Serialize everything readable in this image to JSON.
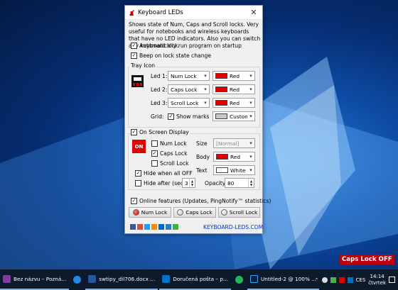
{
  "window": {
    "title": "Keyboard LEDs",
    "close_icon": "close-icon"
  },
  "description": "Shows state of Num, Caps and Scroll locks. Very useful for notebooks and wireless keyboards that have no LED indicators. Also you can switch any keyboard lock.",
  "options": {
    "autorun": "Automatically run program on startup",
    "beep": "Beep on lock state change"
  },
  "tray": {
    "group_label": "Tray Icon",
    "leds": [
      {
        "label": "Led 1:",
        "lock": "Num Lock",
        "color": "Red",
        "color_hex": "#e00000"
      },
      {
        "label": "Led 2:",
        "lock": "Caps Lock",
        "color": "Red",
        "color_hex": "#e00000"
      },
      {
        "label": "Led 3:",
        "lock": "Scroll Lock",
        "color": "Red",
        "color_hex": "#e00000"
      }
    ],
    "grid_label": "Grid:",
    "show_marks": "Show marks",
    "grid_color": "Custom...",
    "grid_color_hex": "#c8c8c8"
  },
  "osd": {
    "group_label": "On Screen Display",
    "badge": "ON",
    "num": "Num Lock",
    "caps": "Caps Lock",
    "scroll": "Scroll Lock",
    "size_label": "Size",
    "size_value": "[Normal]",
    "body_label": "Body",
    "body_value": "Red",
    "body_hex": "#e00000",
    "text_label": "Text",
    "text_value": "White",
    "text_hex": "#ffffff",
    "hide_all": "Hide when all OFF",
    "hide_after": "Hide after (sec)",
    "hide_after_value": "3",
    "opacity_label": "Opacity",
    "opacity_value": "80"
  },
  "online": "Online features (Updates, PingNotify™ statistics)",
  "lock_buttons": [
    {
      "label": "Num Lock",
      "state": "on"
    },
    {
      "label": "Caps Lock",
      "state": "off"
    },
    {
      "label": "Scroll Lock",
      "state": "off"
    }
  ],
  "website": "KEYBOARD-LEDS.COM",
  "osd_toast": "Caps Lock OFF",
  "taskbar": {
    "items": [
      {
        "label": "Bez názvu – Pozná...",
        "color": "#7b3fa0"
      },
      {
        "label": "",
        "color": "#1e88e5"
      },
      {
        "label": "swtipy_dil706.docx ...",
        "color": "#2b579a"
      },
      {
        "label": "Doručená pošta – p...",
        "color": "#0072c6"
      },
      {
        "label": "",
        "color": "#1db954"
      },
      {
        "label": "Untitled-2 @ 100% ...",
        "color": "#31a8ff"
      },
      {
        "label": "",
        "color": "#555"
      }
    ],
    "lang": "CES",
    "time": "14:14",
    "day": "čtvrtek"
  }
}
